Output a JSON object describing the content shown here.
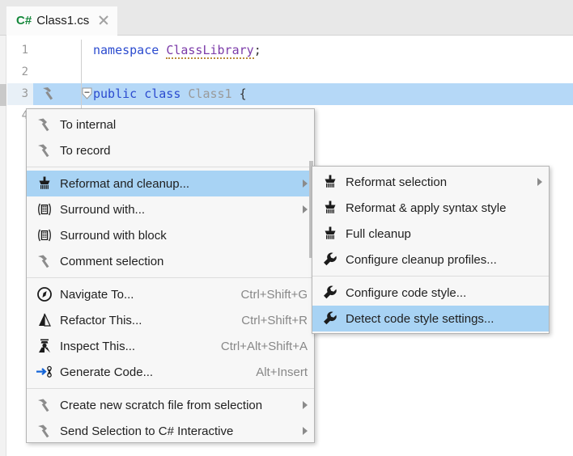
{
  "tab": {
    "lang_badge": "C#",
    "title": "Class1.cs",
    "close_icon": "close-icon"
  },
  "editor": {
    "lines": [
      {
        "no": "1",
        "text": "namespace ClassLibrary;",
        "selected": false
      },
      {
        "no": "2",
        "text": "",
        "selected": false
      },
      {
        "no": "3",
        "text": "public class Class1 {",
        "selected": true
      },
      {
        "no": "4",
        "text": "",
        "selected": false
      }
    ],
    "code": {
      "kw_namespace": "namespace",
      "ns_name": "ClassLibrary",
      "semicolon": ";",
      "kw_public": "public",
      "kw_class": "class",
      "class_name": "Class1",
      "brace": "{"
    },
    "gutter_icon": "hammer-icon",
    "fold_icon": "fold-collapse-icon"
  },
  "colors": {
    "highlight": "#a8d3f4",
    "selection": "#b5d8f7",
    "keyword": "#2b4bcf",
    "type": "#7b3aa8",
    "menu_bg": "#f7f7f7",
    "tabbar_bg": "#e8e8e8",
    "csharp_green": "#16883c"
  },
  "context_menu": {
    "items": [
      {
        "label": "To internal",
        "icon": "hammer-icon",
        "shortcut": "",
        "arrow": false,
        "highlighted": false
      },
      {
        "label": "To record",
        "icon": "hammer-icon",
        "shortcut": "",
        "arrow": false,
        "highlighted": false
      },
      {
        "separator": true
      },
      {
        "label": "Reformat and cleanup...",
        "icon": "broom-icon",
        "shortcut": "",
        "arrow": true,
        "highlighted": true
      },
      {
        "label": "Surround with...",
        "icon": "surround-icon",
        "shortcut": "",
        "arrow": true,
        "highlighted": false
      },
      {
        "label": "Surround with block",
        "icon": "surround-icon",
        "shortcut": "",
        "arrow": false,
        "highlighted": false
      },
      {
        "label": "Comment selection",
        "icon": "hammer-icon",
        "shortcut": "",
        "arrow": false,
        "highlighted": false
      },
      {
        "separator": true
      },
      {
        "label": "Navigate To...",
        "icon": "compass-icon",
        "shortcut": "Ctrl+Shift+G",
        "arrow": false,
        "highlighted": false
      },
      {
        "label": "Refactor This...",
        "icon": "pyramid-icon",
        "shortcut": "Ctrl+Shift+R",
        "arrow": false,
        "highlighted": false
      },
      {
        "label": "Inspect This...",
        "icon": "inspector-icon",
        "shortcut": "Ctrl+Alt+Shift+A",
        "arrow": false,
        "highlighted": false
      },
      {
        "label": "Generate Code...",
        "icon": "generate-icon",
        "shortcut": "Alt+Insert",
        "arrow": false,
        "highlighted": false
      },
      {
        "separator": true
      },
      {
        "label": "Create new scratch file from selection",
        "icon": "hammer-icon",
        "shortcut": "",
        "arrow": true,
        "highlighted": false
      },
      {
        "label": "Send Selection to C# Interactive",
        "icon": "hammer-icon",
        "shortcut": "",
        "arrow": true,
        "highlighted": false
      }
    ]
  },
  "submenu": {
    "items": [
      {
        "label": "Reformat selection",
        "icon": "broom-icon",
        "arrow": true,
        "highlighted": false
      },
      {
        "label": "Reformat & apply syntax style",
        "icon": "broom-icon",
        "arrow": false,
        "highlighted": false
      },
      {
        "label": "Full cleanup",
        "icon": "broom-icon",
        "arrow": false,
        "highlighted": false
      },
      {
        "label": "Configure cleanup profiles...",
        "icon": "wrench-icon",
        "arrow": false,
        "highlighted": false
      },
      {
        "separator": true
      },
      {
        "label": "Configure code style...",
        "icon": "wrench-icon",
        "arrow": false,
        "highlighted": false
      },
      {
        "label": "Detect code style settings...",
        "icon": "wrench-icon",
        "arrow": false,
        "highlighted": true
      }
    ]
  }
}
